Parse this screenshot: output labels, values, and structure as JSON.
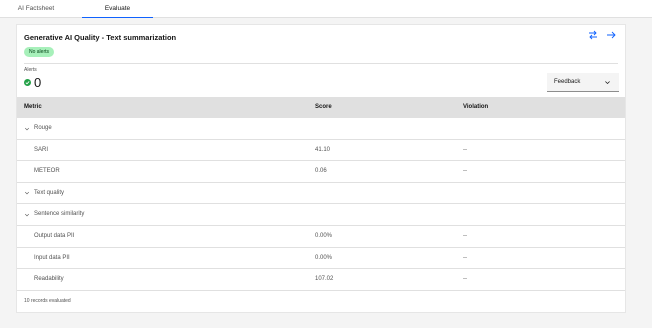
{
  "tabs": [
    {
      "label": "AI Factsheet"
    },
    {
      "label": "Evaluate"
    }
  ],
  "card": {
    "title": "Generative AI Quality - Text summarization",
    "badge": "No alerts",
    "alerts_label": "Alerts",
    "alerts_count": "0",
    "feedback_label": "Feedback"
  },
  "table": {
    "headers": [
      "Metric",
      "Score",
      "Violation"
    ],
    "rows": [
      {
        "metric": "Rouge",
        "score": "",
        "violation": ""
      },
      {
        "metric": "SARI",
        "score": "41.10",
        "violation": "--"
      },
      {
        "metric": "METEOR",
        "score": "0.06",
        "violation": "--"
      },
      {
        "metric": "Text quality",
        "score": "",
        "violation": ""
      },
      {
        "metric": "Sentence similarity",
        "score": "",
        "violation": ""
      },
      {
        "metric": "Output data PII",
        "score": "0.00%",
        "violation": "--"
      },
      {
        "metric": "Input data PII",
        "score": "0.00%",
        "violation": "--"
      },
      {
        "metric": "Readability",
        "score": "107.02",
        "violation": "--"
      }
    ]
  },
  "footer": "10 records evaluated",
  "colors": {
    "accent": "#0f62fe",
    "success": "#24a148",
    "badge_bg": "#a7f0ba"
  }
}
